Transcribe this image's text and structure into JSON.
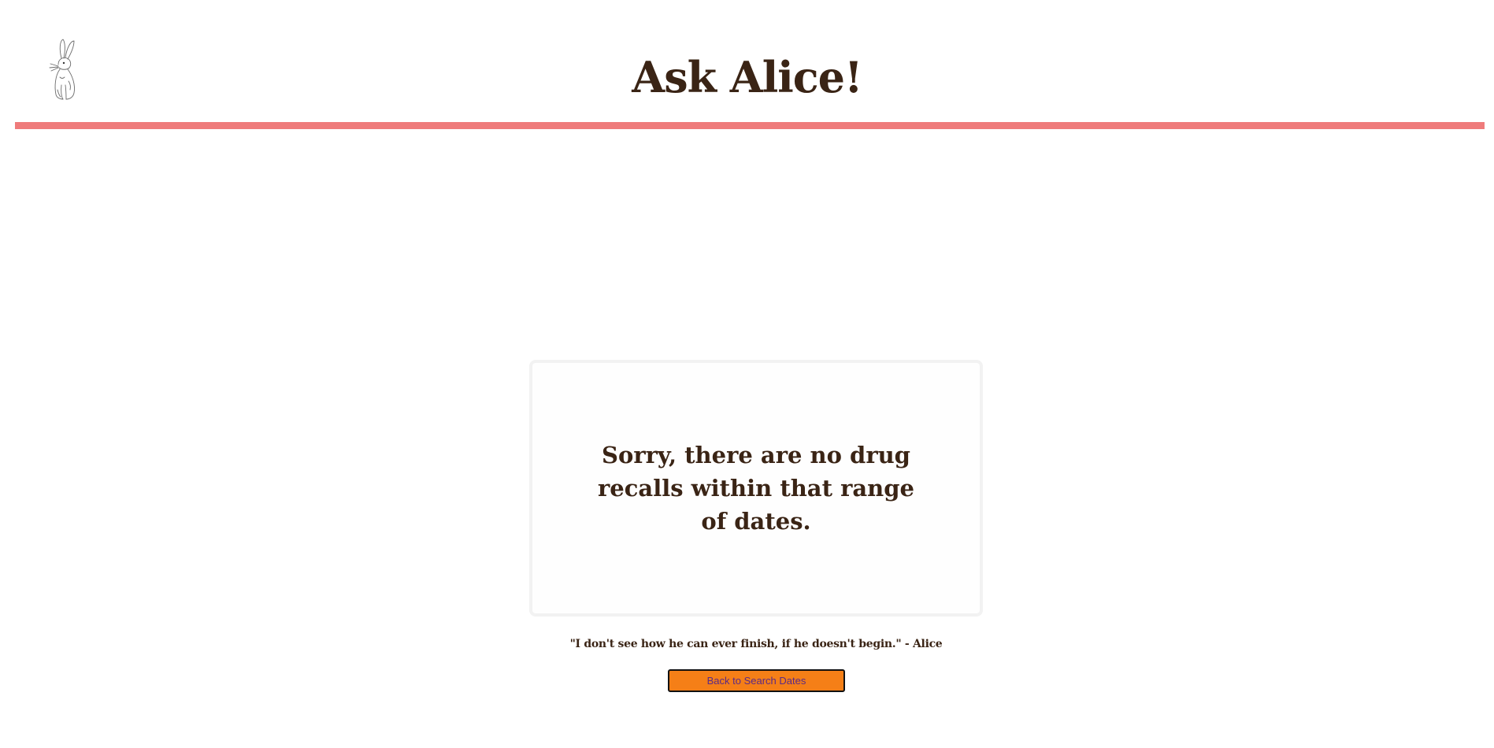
{
  "header": {
    "title": "Ask Alice!",
    "logo_icon": "rabbit-icon",
    "rule_color": "#ef7b7b"
  },
  "main": {
    "message": "Sorry, there are no drug recalls within that range of dates.",
    "quote": "\"I don't see how he can ever finish, if he doesn't begin.\" - Alice",
    "back_button_label": "Back to Search Dates"
  },
  "colors": {
    "text": "#3a2415",
    "button_bg": "#f57f17",
    "button_text": "#5b2a86"
  }
}
